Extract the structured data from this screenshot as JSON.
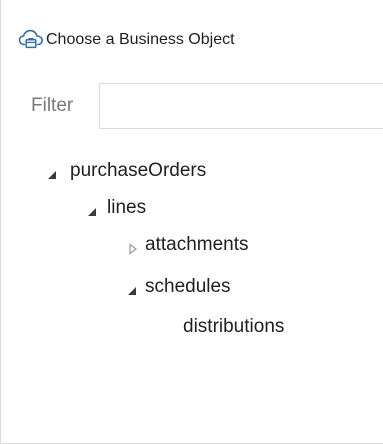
{
  "dialog": {
    "title": "Choose a Business Object",
    "title_icon": "cloud-icon"
  },
  "filter": {
    "label": "Filter",
    "value": "",
    "placeholder": ""
  },
  "tree": {
    "nodes": [
      {
        "label": "purchaseOrders",
        "state": "expanded"
      },
      {
        "label": "lines",
        "state": "expanded"
      },
      {
        "label": "attachments",
        "state": "collapsed"
      },
      {
        "label": "schedules",
        "state": "expanded"
      },
      {
        "label": "distributions",
        "state": "leaf"
      }
    ]
  },
  "colors": {
    "accent": "#2f6fb0",
    "text": "#1f1f1f",
    "muted": "#7a7a7a",
    "border": "#dcdcdc"
  }
}
